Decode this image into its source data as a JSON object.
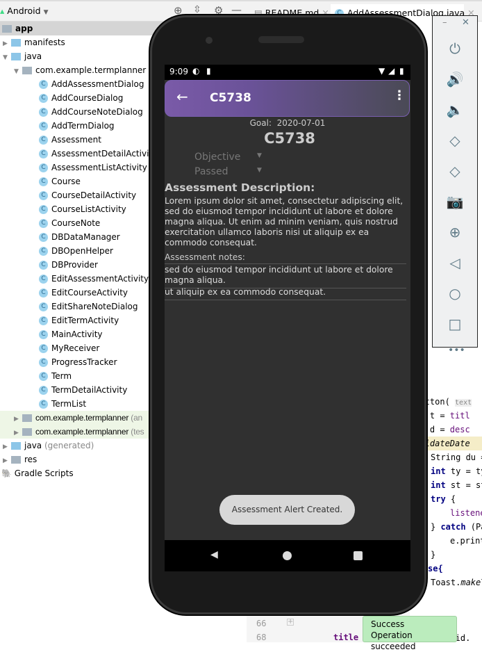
{
  "ide": {
    "view_selector": "Android",
    "tabs": [
      {
        "label": "README.md",
        "active": false
      },
      {
        "label": "AddAssessmentDialog.java",
        "active": true
      }
    ],
    "tree": {
      "app": "app",
      "manifests": "manifests",
      "java": "java",
      "package": "com.example.termplanner",
      "classes": [
        "AddAssessmentDialog",
        "AddCourseDialog",
        "AddCourseNoteDialog",
        "AddTermDialog",
        "Assessment",
        "AssessmentDetailActivity",
        "AssessmentListActivity",
        "Course",
        "CourseDetailActivity",
        "CourseListActivity",
        "CourseNote",
        "DBDataManager",
        "DBOpenHelper",
        "DBProvider",
        "EditAssessmentActivity",
        "EditCourseActivity",
        "EditShareNoteDialog",
        "EditTermActivity",
        "MainActivity",
        "MyReceiver",
        "ProgressTracker",
        "Term",
        "TermDetailActivity",
        "TermList"
      ],
      "package_android_test": "com.example.termplanner",
      "package_android_test_suffix": "(an",
      "package_test": "com.example.termplanner",
      "package_test_suffix": "(tes",
      "java_generated": "java",
      "java_generated_suffix": "(generated)",
      "res": "res",
      "gradle": "Gradle Scripts"
    },
    "code_fragments": {
      "l1": "eButton(",
      "l1_hint": "text",
      "l2a": "ing t = ",
      "l2b": "titl",
      "l3a": "ing d = ",
      "l3b": "desc",
      "l4": "validateDate",
      "l5": "String du =",
      "l6a": "int",
      "l6b": " ty = ty",
      "l7a": "int",
      "l7b": " st = st",
      "l8a": "try",
      "l8b": " {",
      "l9": "listene",
      "l10a": "} ",
      "l10b": "catch",
      "l10c": " (Pa",
      "l11": "e.print",
      "l12": "}",
      "l13": "se{",
      "l14a": "Toast.",
      "l14b": "makeT",
      "l_title": "title",
      "l_rid": "(R.id."
    },
    "line_numbers": [
      "66",
      "68"
    ],
    "balloon": {
      "title": "Success",
      "message": "Operation succeeded"
    }
  },
  "emulator_panel": {
    "buttons": [
      "power-icon",
      "volume-up-icon",
      "volume-down-icon",
      "rotate-left-icon",
      "rotate-right-icon",
      "camera-icon",
      "zoom-icon",
      "back-icon",
      "home-icon",
      "overview-icon",
      "more-icon"
    ]
  },
  "phone": {
    "status_time": "9:09",
    "app_bar_title": "C5738",
    "goal_label": "Goal:",
    "goal_date": "2020-07-01",
    "heading": "C5738",
    "type_spinner": "Objective",
    "status_spinner": "Passed",
    "description_label": "Assessment Description:",
    "description": "Lorem ipsum dolor sit amet, consectetur adipiscing elit, sed do eiusmod tempor incididunt ut labore et dolore magna aliqua. Ut enim ad minim veniam, quis nostrud exercitation ullamco laboris nisi ut aliquip ex ea commodo consequat.",
    "notes_label": "Assessment notes:",
    "notes": [
      " sed do eiusmod tempor incididunt ut labore et dolore magna aliqua.",
      "ut aliquip ex ea commodo consequat."
    ],
    "toast": "Assessment Alert Created.",
    "colors": {
      "app_bar": "#7a5aa8",
      "background": "#303030"
    }
  }
}
